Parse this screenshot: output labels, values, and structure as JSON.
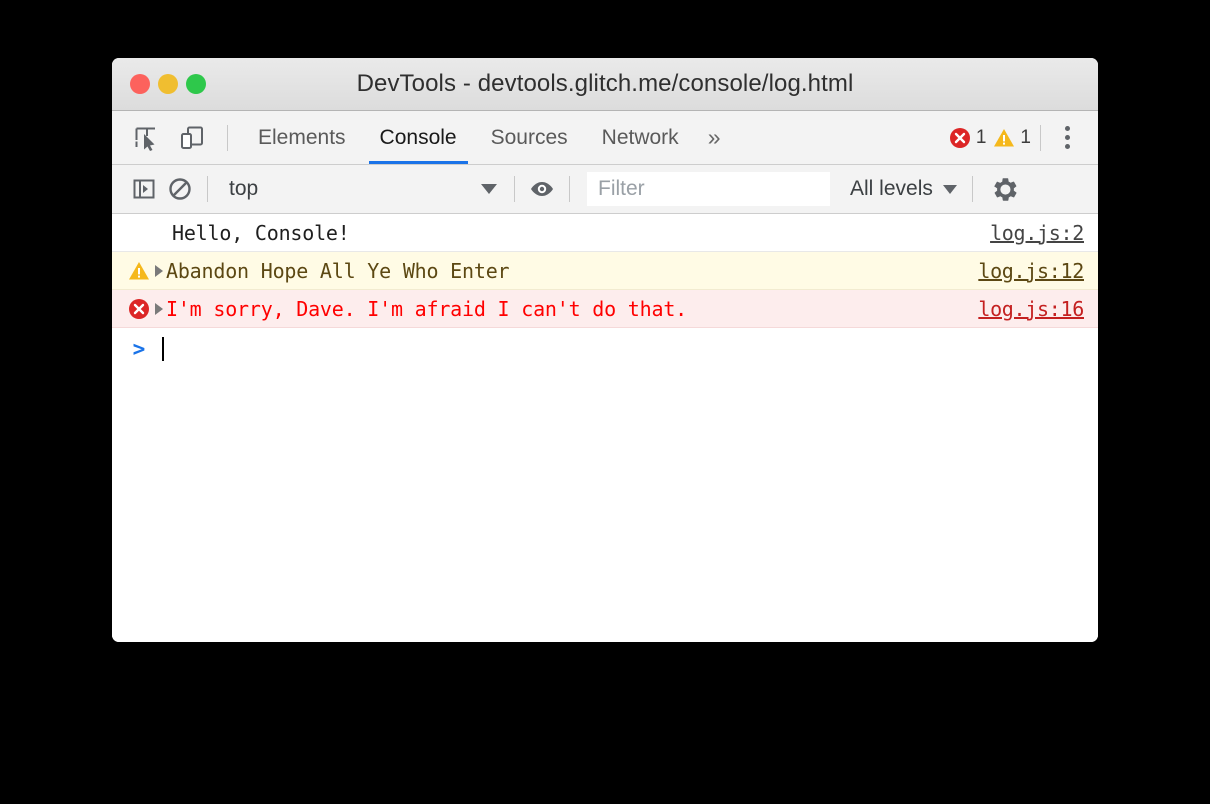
{
  "window": {
    "title": "DevTools - devtools.glitch.me/console/log.html",
    "traffic_lights": [
      {
        "name": "close",
        "color": "#fc625d"
      },
      {
        "name": "minimize",
        "color": "#f0be30"
      },
      {
        "name": "zoom",
        "color": "#2ec84b"
      }
    ]
  },
  "tabbar": {
    "inspect_icon": "inspect-element-icon",
    "device_icon": "device-toolbar-icon",
    "tabs": [
      {
        "label": "Elements",
        "active": false
      },
      {
        "label": "Console",
        "active": true
      },
      {
        "label": "Sources",
        "active": false
      },
      {
        "label": "Network",
        "active": false
      }
    ],
    "more_tabs_label": "»",
    "error_count": "1",
    "warning_count": "1",
    "menu_icon": "kebab-menu-icon"
  },
  "console_toolbar": {
    "sidebar_icon": "console-sidebar-icon",
    "clear_icon": "clear-console-icon",
    "context": {
      "value": "top",
      "caret": "chevron-down-icon"
    },
    "eye_icon": "live-expression-eye-icon",
    "filter": {
      "placeholder": "Filter",
      "value": ""
    },
    "levels": {
      "value": "All levels",
      "caret": "chevron-down-icon"
    },
    "settings_icon": "settings-gear-icon"
  },
  "console_messages": [
    {
      "level": "info",
      "icon": "",
      "expandable": false,
      "text": "Hello, Console!",
      "source": "log.js:2"
    },
    {
      "level": "warning",
      "icon": "warning-triangle-icon",
      "expandable": true,
      "text": "Abandon Hope All Ye Who Enter",
      "source": "log.js:12"
    },
    {
      "level": "error",
      "icon": "error-circle-icon",
      "expandable": true,
      "text": "I'm sorry, Dave. I'm afraid I can't do that.",
      "source": "log.js:16"
    }
  ],
  "prompt": {
    "chevron": ">",
    "value": ""
  },
  "colors": {
    "accent": "#1a73e8",
    "error": "#ff0000",
    "error_badge": "#dc2626",
    "warning_badge": "#f5b81b",
    "warning_row_bg": "#fffbe5",
    "error_row_bg": "#fdeded"
  }
}
